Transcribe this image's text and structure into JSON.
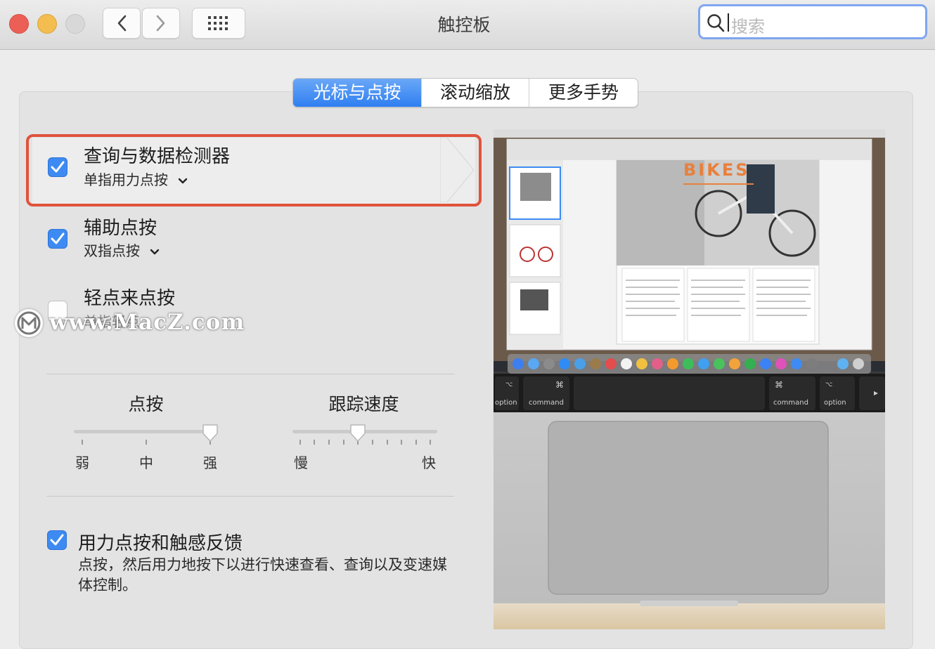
{
  "window": {
    "title": "触控板",
    "search_placeholder": "搜索"
  },
  "tabs": [
    {
      "label": "光标与点按",
      "active": true
    },
    {
      "label": "滚动缩放",
      "active": false
    },
    {
      "label": "更多手势",
      "active": false
    }
  ],
  "options": [
    {
      "title": "查询与数据检测器",
      "sub": "单指用力点按",
      "checked": true,
      "selected": true
    },
    {
      "title": "辅助点按",
      "sub": "双指点按",
      "checked": true
    },
    {
      "title": "轻点来点按",
      "sub": "单指轻点",
      "checked": false
    }
  ],
  "sliders": {
    "click": {
      "label": "点按",
      "ticks": [
        "弱",
        "中",
        "强"
      ],
      "value_fraction": 1.0
    },
    "tracking": {
      "label": "跟踪速度",
      "min_label": "慢",
      "max_label": "快",
      "value_fraction": 0.4
    }
  },
  "force_click": {
    "title": "用力点按和触感反馈",
    "description": "点按，然后用力地按下以进行快速查看、查询以及变速媒体控制。",
    "checked": true
  },
  "watermark": {
    "text": "www.MacZ.com"
  },
  "preview": {
    "doc_title": "BIKES",
    "keys": [
      {
        "symbol": "⌥",
        "label": "option"
      },
      {
        "symbol": "⌘",
        "label": "command"
      },
      {
        "symbol": "⌘",
        "label": "command"
      },
      {
        "symbol": "⌥",
        "label": "option"
      }
    ],
    "colors": {
      "accent": "#3d8bf2",
      "highlight_box": "#e0533c",
      "title_orange": "#e8803c"
    }
  }
}
